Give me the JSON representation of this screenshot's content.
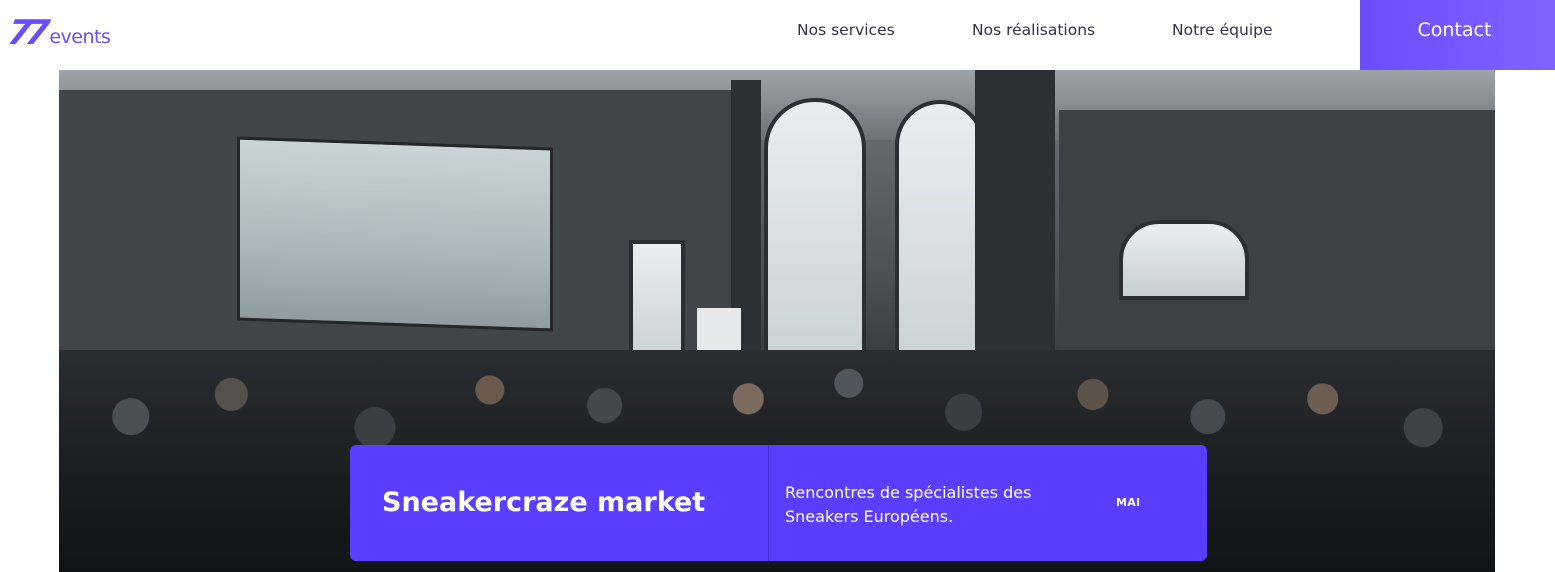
{
  "header": {
    "logo": {
      "mark": "77",
      "word": "events"
    },
    "nav": [
      {
        "label": "Nos services"
      },
      {
        "label": "Nos réalisations"
      },
      {
        "label": "Notre équipe"
      }
    ],
    "contact_label": "Contact"
  },
  "hero": {
    "image_alt": "photo-crowd-sneaker-market",
    "card": {
      "title": "Sneakercraze market",
      "description": "Rencontres de spécialistes des Sneakers Européens.",
      "month": "MAI"
    }
  },
  "colors": {
    "accent": "#5b3dff",
    "contact_bg": "#6b4dff",
    "nav_text": "#333344"
  }
}
